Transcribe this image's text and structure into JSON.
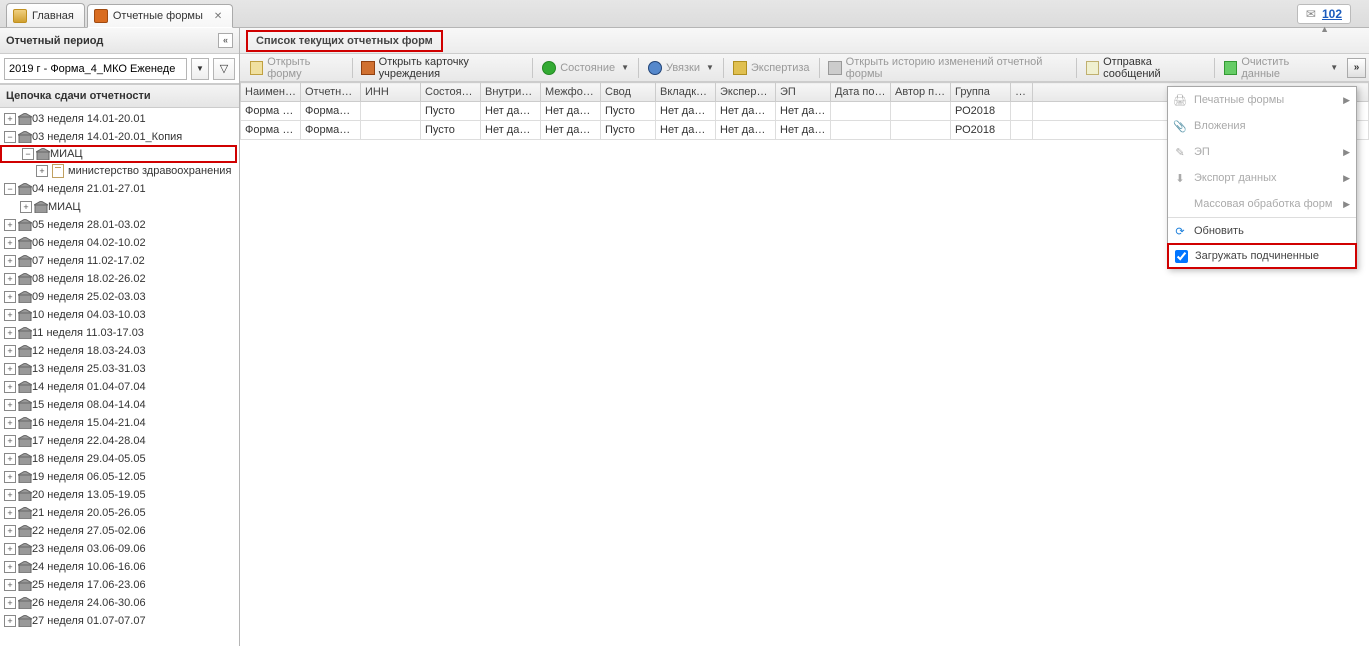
{
  "tabs": {
    "home": "Главная",
    "forms": "Отчетные формы"
  },
  "messages": {
    "count": "102"
  },
  "panel": {
    "period_title": "Отчетный период",
    "period_value": "2019 г - Форма_4_МКО Еженеде",
    "chain_title": "Цепочка сдачи отчетности"
  },
  "tree": {
    "n0": "03 неделя 14.01-20.01",
    "n1": "03 неделя 14.01-20.01_Копия",
    "n1_1": "МИАЦ",
    "n1_1_1": "министерство здравоохранения",
    "n2": "04 неделя 21.01-27.01",
    "n2_1": "МИАЦ",
    "n3": "05 неделя 28.01-03.02",
    "n4": "06 неделя 04.02-10.02",
    "n5": "07 неделя 11.02-17.02",
    "n6": "08 неделя 18.02-26.02",
    "n7": "09 неделя 25.02-03.03",
    "n8": "10 неделя 04.03-10.03",
    "n9": "11 неделя 11.03-17.03",
    "n10": "12 неделя 18.03-24.03",
    "n11": "13 неделя 25.03-31.03",
    "n12": "14 неделя 01.04-07.04",
    "n13": "15 неделя 08.04-14.04",
    "n14": "16 неделя 15.04-21.04",
    "n15": "17 неделя 22.04-28.04",
    "n16": "18 неделя 29.04-05.05",
    "n17": "19 неделя 06.05-12.05",
    "n18": "20 неделя 13.05-19.05",
    "n19": "21 неделя 20.05-26.05",
    "n20": "22 неделя 27.05-02.06",
    "n21": "23 неделя 03.06-09.06",
    "n22": "24 неделя 10.06-16.06",
    "n23": "25 неделя 17.06-23.06",
    "n24": "26 неделя 24.06-30.06",
    "n25": "27 неделя 01.07-07.07"
  },
  "list_caption": "Список текущих отчетных форм",
  "toolbar": {
    "open_form": "Открыть форму",
    "open_card": "Открыть карточку учреждения",
    "state": "Состояние",
    "links": "Увязки",
    "expertise": "Экспертиза",
    "history": "Открыть историю изменений отчетной формы",
    "send": "Отправка сообщений",
    "clear": "Очистить данные"
  },
  "grid": {
    "headers": {
      "name": "Наимен…",
      "reporting": "Отчетн…",
      "inn": "ИНН",
      "state": "Состоя…",
      "intra": "Внутри…",
      "inter": "Межфо…",
      "svod": "Свод",
      "tabs": "Вкладк…",
      "expert": "Экспер…",
      "ep": "ЭП",
      "datep": "Дата по…",
      "author": "Автор п…",
      "group": "Группа",
      "dots": "…"
    },
    "rows": [
      {
        "name": "Форма …",
        "reporting": "Форма…",
        "inn": "",
        "state": "Пусто",
        "intra": "Нет да…",
        "inter": "Нет да…",
        "svod": "Пусто",
        "tabs": "Нет да…",
        "expert": "Нет да…",
        "ep": "Нет да…",
        "datep": "",
        "author": "",
        "group": "РО2018",
        "dots": ""
      },
      {
        "name": "Форма …",
        "reporting": "Форма…",
        "inn": "",
        "state": "Пусто",
        "intra": "Нет да…",
        "inter": "Нет да…",
        "svod": "Пусто",
        "tabs": "Нет да…",
        "expert": "Нет да…",
        "ep": "Нет да…",
        "datep": "",
        "author": "",
        "group": "РО2018",
        "dots": ""
      }
    ]
  },
  "menu": {
    "print": "Печатные формы",
    "attach": "Вложения",
    "ep": "ЭП",
    "export": "Экспорт данных",
    "mass": "Массовая обработка форм",
    "refresh": "Обновить",
    "loadsub": "Загружать подчиненные"
  }
}
